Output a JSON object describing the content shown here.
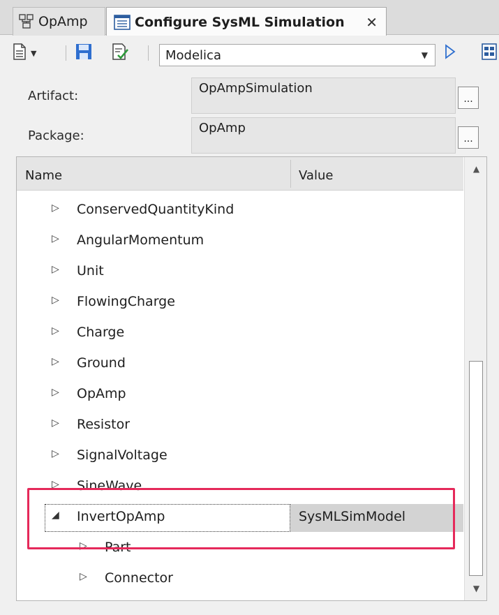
{
  "tabs": [
    {
      "label": "OpAmp",
      "icon": "diagram-icon"
    },
    {
      "label": "Configure SysML Simulation",
      "icon": "document-icon",
      "close": "✕"
    }
  ],
  "toolbar": {
    "new_icon": "new-document-icon",
    "save_icon": "save-icon",
    "validate_icon": "validate-icon",
    "language": "Modelica",
    "run_icon": "run-icon",
    "extra_icon": "export-icon"
  },
  "form": {
    "artifact_label": "Artifact:",
    "artifact_value": "OpAmpSimulation",
    "package_label": "Package:",
    "package_value": "OpAmp",
    "browse_label": "..."
  },
  "grid": {
    "columns": {
      "name": "Name",
      "value": "Value"
    },
    "rows": [
      {
        "label": "ConservedQuantityKind",
        "expanded": false,
        "value": ""
      },
      {
        "label": "AngularMomentum",
        "expanded": false,
        "value": ""
      },
      {
        "label": "Unit",
        "expanded": false,
        "value": ""
      },
      {
        "label": "FlowingCharge",
        "expanded": false,
        "value": ""
      },
      {
        "label": "Charge",
        "expanded": false,
        "value": ""
      },
      {
        "label": "Ground",
        "expanded": false,
        "value": ""
      },
      {
        "label": "OpAmp",
        "expanded": false,
        "value": ""
      },
      {
        "label": "Resistor",
        "expanded": false,
        "value": ""
      },
      {
        "label": "SignalVoltage",
        "expanded": false,
        "value": ""
      },
      {
        "label": "SineWave",
        "expanded": false,
        "value": ""
      },
      {
        "label": "InvertOpAmp",
        "expanded": true,
        "value": "SysMLSimModel",
        "selected": true
      },
      {
        "label": "Part",
        "expanded": false,
        "value": "",
        "child": true
      },
      {
        "label": "Connector",
        "expanded": false,
        "value": "",
        "child": true
      }
    ]
  },
  "colors": {
    "highlight": "#e5295a",
    "selected_value_bg": "#d3d3d3",
    "save_blue": "#2f6fcf"
  }
}
